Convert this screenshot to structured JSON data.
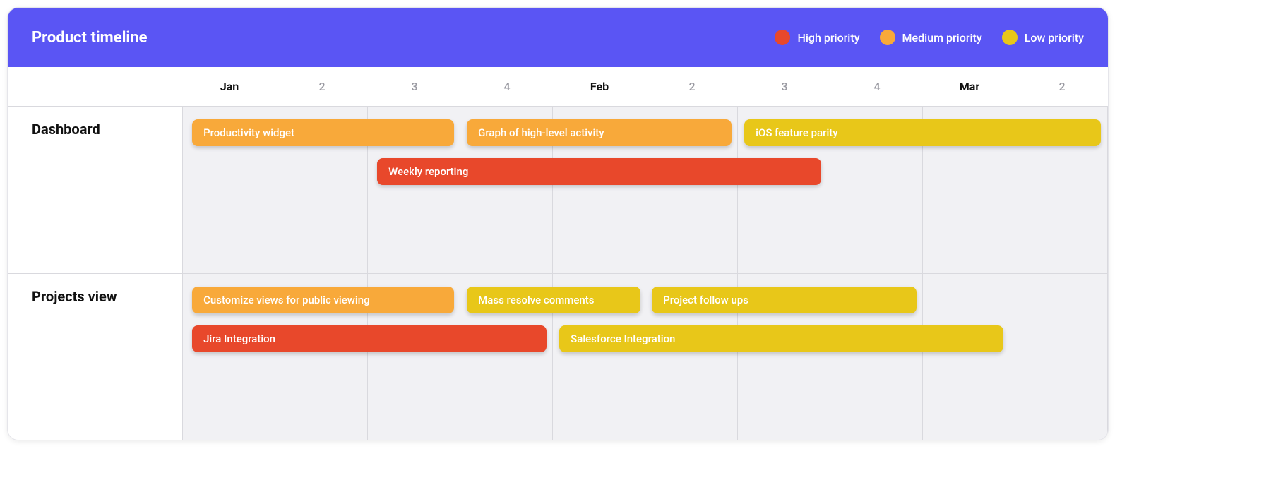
{
  "header": {
    "title": "Product timeline",
    "legend": [
      {
        "label": "High priority",
        "priority": "high"
      },
      {
        "label": "Medium priority",
        "priority": "medium"
      },
      {
        "label": "Low priority",
        "priority": "low"
      }
    ]
  },
  "colors": {
    "high": "#e8482b",
    "medium": "#f8a93a",
    "low": "#e8c719"
  },
  "columns": [
    {
      "label": "Jan",
      "bold": true
    },
    {
      "label": "2",
      "bold": false
    },
    {
      "label": "3",
      "bold": false
    },
    {
      "label": "4",
      "bold": false
    },
    {
      "label": "Feb",
      "bold": true
    },
    {
      "label": "2",
      "bold": false
    },
    {
      "label": "3",
      "bold": false
    },
    {
      "label": "4",
      "bold": false
    },
    {
      "label": "Mar",
      "bold": true
    },
    {
      "label": "2",
      "bold": false
    }
  ],
  "rows": [
    {
      "id": "dashboard",
      "label": "Dashboard",
      "bars": [
        {
          "label": "Productivity widget",
          "priority": "medium",
          "start_col": 0.1,
          "span_cols": 2.83,
          "lane": 0
        },
        {
          "label": "Graph of high-level activity",
          "priority": "medium",
          "start_col": 3.07,
          "span_cols": 2.86,
          "lane": 0
        },
        {
          "label": "iOS feature parity",
          "priority": "low",
          "start_col": 6.07,
          "span_cols": 3.85,
          "lane": 0
        },
        {
          "label": "Weekly reporting",
          "priority": "high",
          "start_col": 2.1,
          "span_cols": 4.8,
          "lane": 1
        }
      ]
    },
    {
      "id": "projects-view",
      "label": "Projects view",
      "bars": [
        {
          "label": "Customize views for public viewing",
          "priority": "medium",
          "start_col": 0.1,
          "span_cols": 2.83,
          "lane": 0
        },
        {
          "label": "Mass resolve comments",
          "priority": "low",
          "start_col": 3.07,
          "span_cols": 1.88,
          "lane": 0
        },
        {
          "label": "Project follow ups",
          "priority": "low",
          "start_col": 5.07,
          "span_cols": 2.86,
          "lane": 0
        },
        {
          "label": "Jira Integration",
          "priority": "high",
          "start_col": 0.1,
          "span_cols": 3.83,
          "lane": 1
        },
        {
          "label": "Salesforce Integration",
          "priority": "low",
          "start_col": 4.07,
          "span_cols": 4.8,
          "lane": 1
        }
      ]
    }
  ],
  "grid": {
    "total_cols": 10
  }
}
